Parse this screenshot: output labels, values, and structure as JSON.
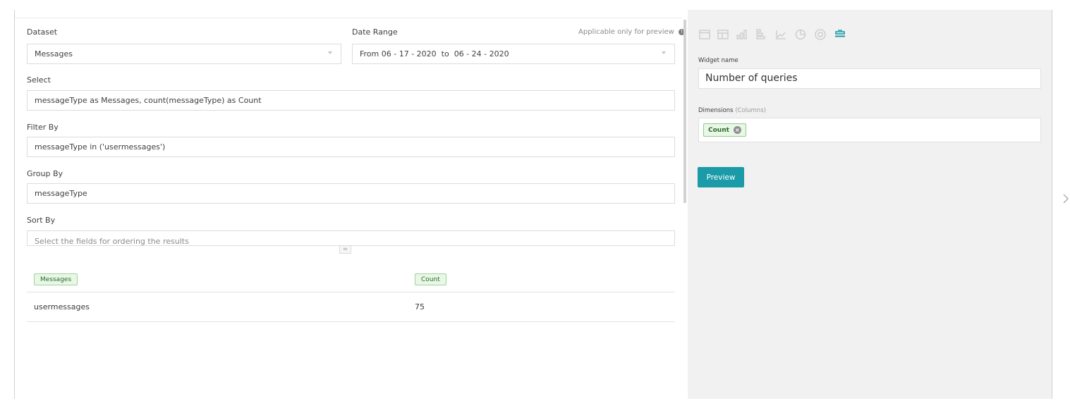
{
  "query": {
    "dataset_label": "Dataset",
    "dataset_value": "Messages",
    "date_range_label": "Date Range",
    "date_range_note": "Applicable only for preview",
    "date_range_value": "From 06 - 17 - 2020  to  06 - 24 - 2020",
    "select_label": "Select",
    "select_value": "messageType as Messages, count(messageType) as Count",
    "filter_label": "Filter By",
    "filter_value": "messageType in ('usermessages')",
    "group_label": "Group By",
    "group_value": "messageType",
    "sort_label": "Sort By",
    "sort_placeholder": "Select the fields for ordering the results",
    "grip_glyph": "="
  },
  "results": {
    "columns": [
      "Messages",
      "Count"
    ],
    "rows": [
      [
        "usermessages",
        "75"
      ]
    ]
  },
  "widget": {
    "chart_icons": [
      "card-icon",
      "table-icon",
      "bar-chart-icon",
      "horizontal-bar-icon",
      "line-chart-icon",
      "pie-chart-icon",
      "donut-chart-icon",
      "kpi-icon"
    ],
    "active_icon": "kpi-icon",
    "accent_color": "#1b9ba7",
    "name_label": "Widget name",
    "name_value": "Number of queries",
    "dimensions_label": "Dimensions",
    "dimensions_hint": "(Columns)",
    "dimension_chip": "Count",
    "preview_label": "Preview"
  }
}
